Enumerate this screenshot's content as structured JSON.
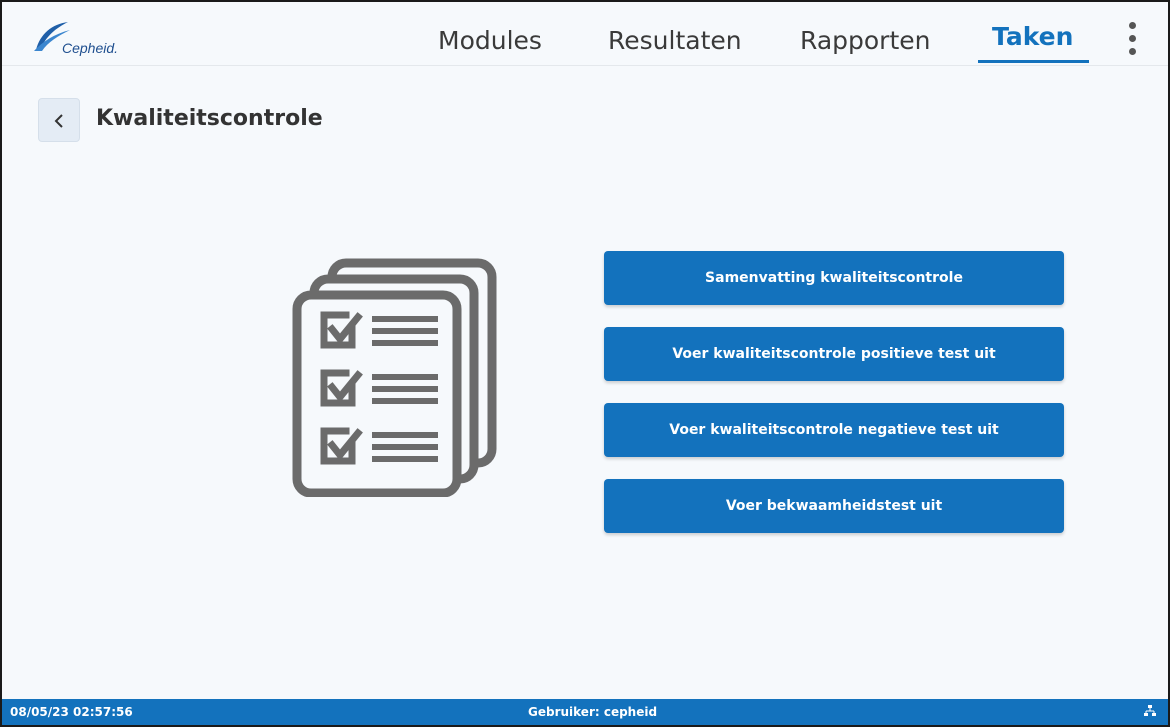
{
  "app": {
    "logo_text": "Cepheid.",
    "brand_color": "#1372bd"
  },
  "nav": {
    "items": [
      {
        "label": "Modules",
        "active": false
      },
      {
        "label": "Resultaten",
        "active": false
      },
      {
        "label": "Rapporten",
        "active": false
      },
      {
        "label": "Taken",
        "active": true
      }
    ],
    "menu_icon": "kebab-menu-icon"
  },
  "page": {
    "title": "Kwaliteitscontrole",
    "back_icon": "chevron-left-icon",
    "illustration_icon": "checklist-stack-icon"
  },
  "actions": [
    {
      "label": "Samenvatting kwaliteitscontrole"
    },
    {
      "label": "Voer kwaliteitscontrole positieve test uit"
    },
    {
      "label": "Voer kwaliteitscontrole negatieve test uit"
    },
    {
      "label": "Voer bekwaamheidstest uit"
    }
  ],
  "status": {
    "datetime": "08/05/23 02:57:56",
    "user": "Gebruiker: cepheid",
    "network_icon": "network-icon"
  }
}
